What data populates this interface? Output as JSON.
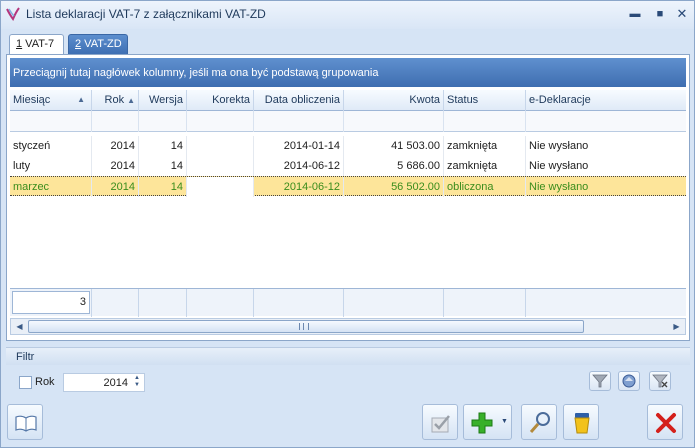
{
  "window": {
    "title": "Lista deklaracji VAT-7 z załącznikami VAT-ZD",
    "controls": {
      "minimize": "▬",
      "maximize": "■",
      "close": "✕"
    }
  },
  "tabs": [
    {
      "hotkey": "1",
      "label": " VAT-7",
      "active": true
    },
    {
      "hotkey": "2",
      "label": " VAT-ZD",
      "active": false
    }
  ],
  "grid": {
    "group_panel_text": "Przeciągnij tutaj nagłówek kolumny, jeśli ma ona być podstawą grupowania",
    "columns": [
      {
        "label": "Miesiąc",
        "sort": "▲",
        "align": "left"
      },
      {
        "label": "Rok",
        "sort": "▲",
        "align": "right"
      },
      {
        "label": "Wersja",
        "sort": "",
        "align": "right"
      },
      {
        "label": "Korekta",
        "sort": "",
        "align": "right"
      },
      {
        "label": "Data obliczenia",
        "sort": "",
        "align": "right"
      },
      {
        "label": "Kwota",
        "sort": "",
        "align": "right"
      },
      {
        "label": "Status",
        "sort": "",
        "align": "left"
      },
      {
        "label": "e-Deklaracje",
        "sort": "",
        "align": "left"
      }
    ],
    "rows": [
      {
        "miesiac": "styczeń",
        "rok": "2014",
        "wersja": "14",
        "korekta": "",
        "data": "2014-01-14",
        "kwota": "41 503.00",
        "status": "zamknięta",
        "edeklaracje": "Nie wysłano",
        "selected": false
      },
      {
        "miesiac": "luty",
        "rok": "2014",
        "wersja": "14",
        "korekta": "",
        "data": "2014-06-12",
        "kwota": "5 686.00",
        "status": "zamknięta",
        "edeklaracje": "Nie wysłano",
        "selected": false
      },
      {
        "miesiac": "marzec",
        "rok": "2014",
        "wersja": "14",
        "korekta": "",
        "data": "2014-06-12",
        "kwota": "56 502.00",
        "status": "obliczona",
        "edeklaracje": "Nie wysłano",
        "selected": true
      }
    ],
    "summary_count": "3",
    "scroll": {
      "left": "◀",
      "right": "▶"
    }
  },
  "filter": {
    "title": "Filtr",
    "rok_label": "Rok",
    "rok_checked": false,
    "rok_value": "2014",
    "spin_up": "▲",
    "spin_down": "▼"
  },
  "toolbar": {
    "add_dropdown": "▼"
  },
  "colors": {
    "selected_row_bg": "#fde59a",
    "selected_row_text": "#3b8d1d",
    "header_blue": "#3f6eb0",
    "window_bg": "#d6e4f5"
  }
}
